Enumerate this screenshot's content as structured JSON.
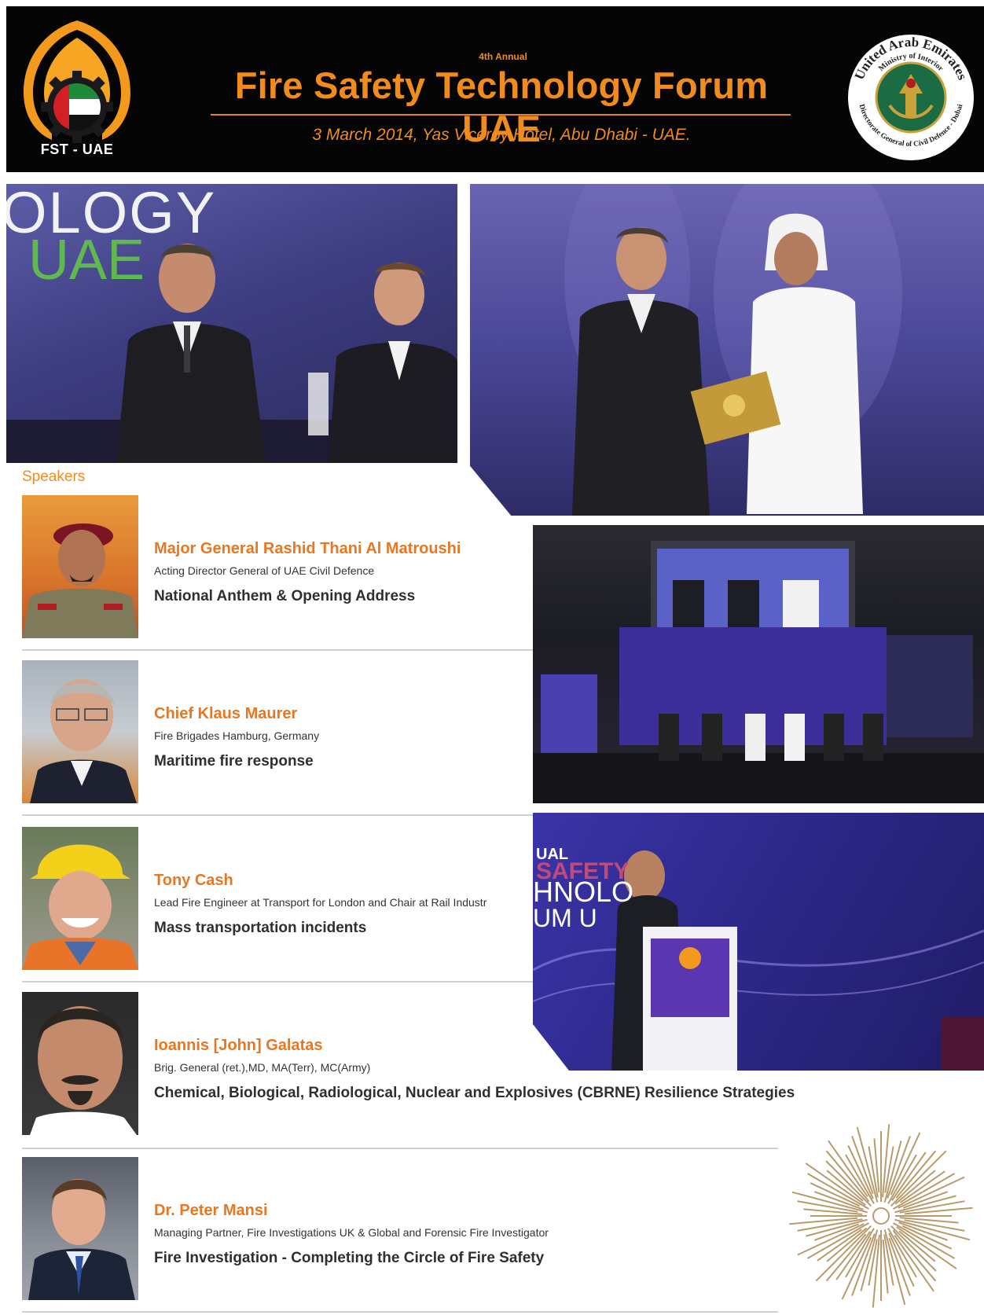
{
  "header": {
    "logo_text": "FST - UAE",
    "edition": "4th Annual",
    "title": "Fire Safety Technology Forum UAE",
    "event_info": "3 March 2014, Yas Viceroy Hotel, Abu Dhabi - UAE.",
    "seal_top_text": "United Arab Emirates",
    "seal_sub_text": "Ministry of Interior",
    "seal_bottom_text": "Directorate General of Civil Defence - Dubai"
  },
  "photos": {
    "photo_1_banner_line1": "OLOGY",
    "photo_1_banner_line2": "UAE",
    "photo_4_banner_1": "UAL",
    "photo_4_banner_2": "SAFETY",
    "photo_4_banner_3": "HNOLO",
    "photo_4_banner_4": "UM U"
  },
  "speakers_section": {
    "title": "Speakers",
    "items": [
      {
        "name": "Major General Rashid Thani Al Matroushi",
        "role": "Acting Director General of UAE Civil Defence",
        "topic": "National Anthem & Opening Address"
      },
      {
        "name": "Chief Klaus Maurer",
        "role": "Fire Brigades Hamburg, Germany",
        "topic": "Maritime fire response"
      },
      {
        "name": "Tony Cash",
        "role": "Lead Fire Engineer at Transport for London and Chair at Rail Industr",
        "topic": "Mass transportation incidents"
      },
      {
        "name": "Ioannis [John] Galatas",
        "role": "Brig. General (ret.),MD, MA(Terr), MC(Army)",
        "topic": "Chemical, Biological, Radiological, Nuclear and Explosives (CBRNE) Resilience Strategies"
      },
      {
        "name": "Dr. Peter Mansi",
        "role": "Managing Partner, Fire Investigations UK & Global and Forensic Fire Investigator",
        "topic": "Fire Investigation - Completing the Circle of Fire Safety"
      }
    ]
  },
  "colors": {
    "header_bg": "#050505",
    "accent_orange": "#f08c1e",
    "name_orange": "#e87722",
    "stage_purple": "#4a4797"
  }
}
